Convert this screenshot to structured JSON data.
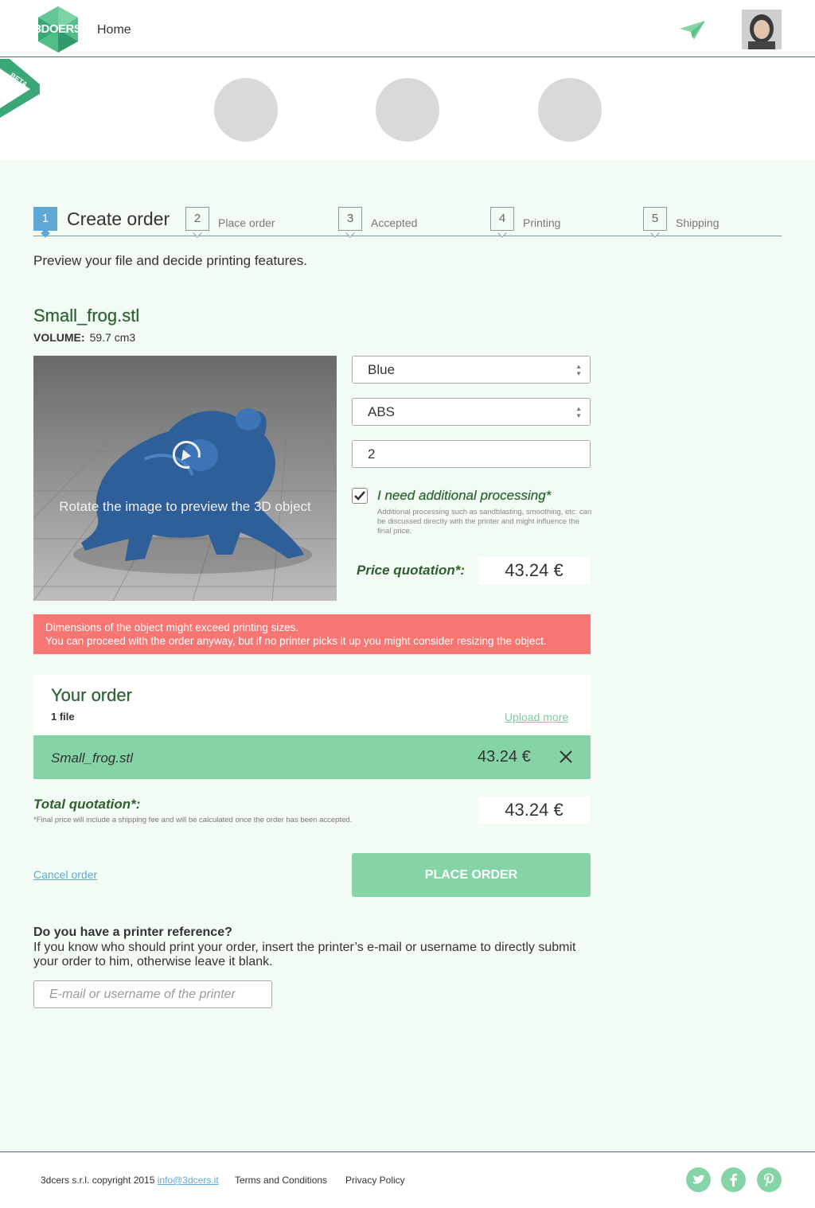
{
  "header": {
    "logo_text": "3DOERS",
    "nav_home": "Home",
    "beta_label": "BETA"
  },
  "steps": [
    {
      "number": "1",
      "label": "Create order",
      "active": true
    },
    {
      "number": "2",
      "label": "Place order"
    },
    {
      "number": "3",
      "label": "Accepted"
    },
    {
      "number": "4",
      "label": "Printing"
    },
    {
      "number": "5",
      "label": "Shipping"
    }
  ],
  "intro": "Preview your file and decide printing features.",
  "file": {
    "name": "Small_frog.stl",
    "volume_label": "VOLUME:",
    "volume_value": "59.7 cm3",
    "preview_hint": "Rotate the image to preview the 3D object"
  },
  "options": {
    "color": "Blue",
    "material": "ABS",
    "quantity": "2",
    "additional_processing_label": "I need additional processing*",
    "additional_processing_checked": true,
    "additional_processing_help": "Additional processing such as sandblasting, smoothing, etc. can be discussed directly with the printer and might influence the final price."
  },
  "price": {
    "label": "Price quotation*:",
    "value": "43.24 €"
  },
  "warning": {
    "line1": "Dimensions of the object might exceed printing sizes.",
    "line2": "You can proceed with the order anyway, but if no printer picks it up you might consider resizing the object."
  },
  "order": {
    "title": "Your order",
    "count": "1 file",
    "upload_more": "Upload more",
    "items": [
      {
        "name": "Small_frog.stl",
        "price": "43.24 €"
      }
    ]
  },
  "total": {
    "label": "Total quotation*:",
    "note": "*Final price will include a shipping fee and will be calculated once the order has been accepted.",
    "value": "43.24 €"
  },
  "actions": {
    "cancel": "Cancel order",
    "place": "PLACE ORDER"
  },
  "printer_ref": {
    "title": "Do you have a printer reference?",
    "description": "If you know who should print your order, insert the printer’s e-mail or username to directly submit your order to him, otherwise leave it blank.",
    "placeholder": "E-mail or username of the printer"
  },
  "footer": {
    "copyright": "3dcers s.r.l. copyright 2015",
    "email": "info@3dcers.it",
    "terms": "Terms and Conditions",
    "privacy": "Privacy Policy",
    "social": [
      "twitter-icon",
      "facebook-icon",
      "pinterest-icon"
    ]
  },
  "colors": {
    "accent_green": "#84d4a5",
    "step_blue": "#5fa8d3",
    "warning_red": "#f77673",
    "page_bg": "#f2fcf4"
  }
}
